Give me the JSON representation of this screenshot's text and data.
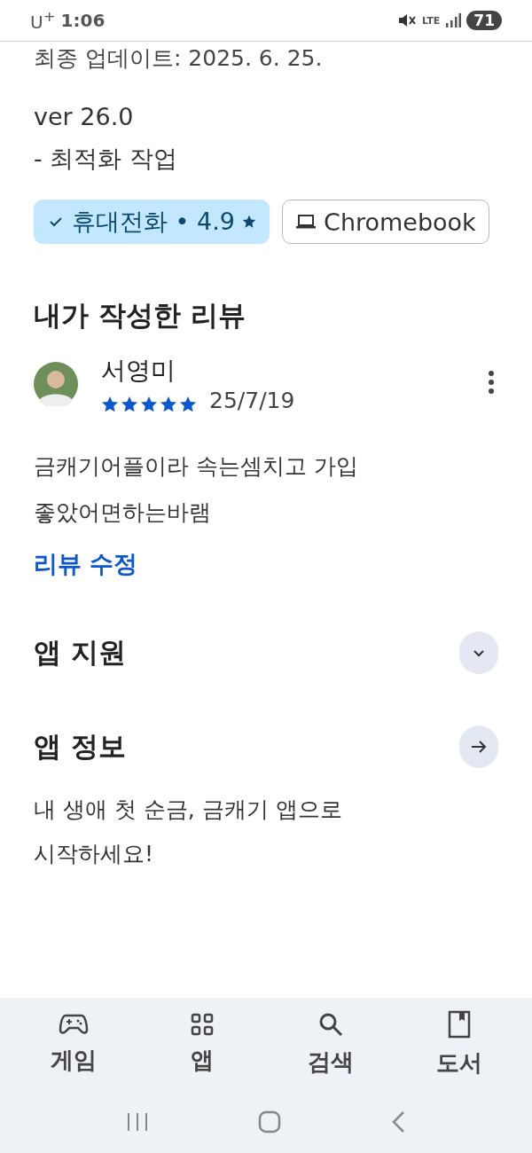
{
  "status_bar": {
    "carrier": "U$^{+}$",
    "time": "1:06",
    "network": "LTE",
    "battery": "71"
  },
  "update": {
    "last_updated": "최종 업데이트: 2025. 6. 25.",
    "notes": [
      "ver 26.0",
      "- 최적화 작업"
    ]
  },
  "device_chips": [
    {
      "kind": "phone",
      "label": "휴대전화 • 4.9",
      "selected": true
    },
    {
      "kind": "laptop",
      "label": "Chromebook",
      "selected": false
    }
  ],
  "my_review": {
    "title": "내가 작성한 리뷰",
    "author": "서영미",
    "stars": 5,
    "date": "25/7/19",
    "text": "금캐기어플이라 속는셈치고 가입\n좋았어면하는바램",
    "edit_link": "리뷰 수정"
  },
  "sections": [
    {
      "kind": "expand",
      "title": "앱 지원"
    },
    {
      "kind": "link",
      "title": "앱 정보",
      "description": "내 생애 첫 순금, 금캐기 앱으로\n시작하세요!"
    }
  ],
  "bottom_nav": [
    {
      "kind": "games",
      "label": "게임",
      "selected": false
    },
    {
      "kind": "apps",
      "label": "앱",
      "selected": false
    },
    {
      "kind": "search",
      "label": "검색",
      "selected": false
    },
    {
      "kind": "books",
      "label": "도서",
      "selected": false
    }
  ]
}
